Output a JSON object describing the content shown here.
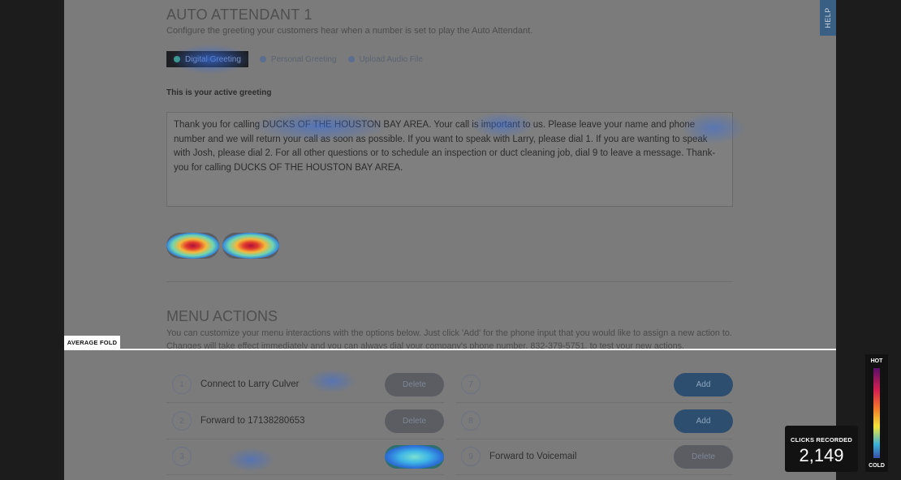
{
  "page": {
    "title": "AUTO ATTENDANT 1",
    "subtitle": "Configure the greeting your customers hear when a number is set to play the Auto Attendant.",
    "help_tab": "HELP"
  },
  "greeting_options": [
    {
      "label": "Digital Greeting",
      "selected": true
    },
    {
      "label": "Personal Greeting",
      "selected": false
    },
    {
      "label": "Upload Audio File",
      "selected": false
    }
  ],
  "active_greeting": {
    "label": "This is your active greeting",
    "text": "Thank you for calling DUCKS OF THE HOUSTON BAY AREA.  Your call is important to us.  Please leave your name and phone number and we will return your call as soon as possible.  If you want to speak with Larry,  please dial 1.   If you are wanting to speak with Josh, please dial 2.  For all other questions or to schedule an inspection or duct cleaning job, dial 9 to leave a message.  Thank-you for calling DUCKS OF THE HOUSTON BAY AREA."
  },
  "menu_actions": {
    "title": "MENU ACTIONS",
    "description": "You can customize your menu interactions with the options below. Just click 'Add' for the phone input that you would like to assign a new action to. Changes will take effect immediately and you can always dial your company's phone number, 832-379-5751, to test your new actions.",
    "left_rows": [
      {
        "number": "1",
        "label": "Connect to Larry Culver",
        "button": "Delete"
      },
      {
        "number": "2",
        "label": "Forward to 17138280653",
        "button": "Delete"
      },
      {
        "number": "3",
        "label": "",
        "button": "Add"
      }
    ],
    "right_rows": [
      {
        "number": "7",
        "label": "",
        "button": "Add"
      },
      {
        "number": "8",
        "label": "",
        "button": "Add"
      },
      {
        "number": "9",
        "label": "Forward to Voicemail",
        "button": "Delete"
      }
    ]
  },
  "overlay": {
    "fold_label": "AVERAGE FOLD",
    "clicks_label": "CLICKS RECORDED",
    "clicks_value": "2,149",
    "legend_hot": "HOT",
    "legend_cold": "COLD"
  },
  "colors": {
    "dimmed_page": "#7b7b7b",
    "frame": "#1c1c1c",
    "add_button": "#2e4e6f",
    "help_tab": "#3a5f85"
  }
}
